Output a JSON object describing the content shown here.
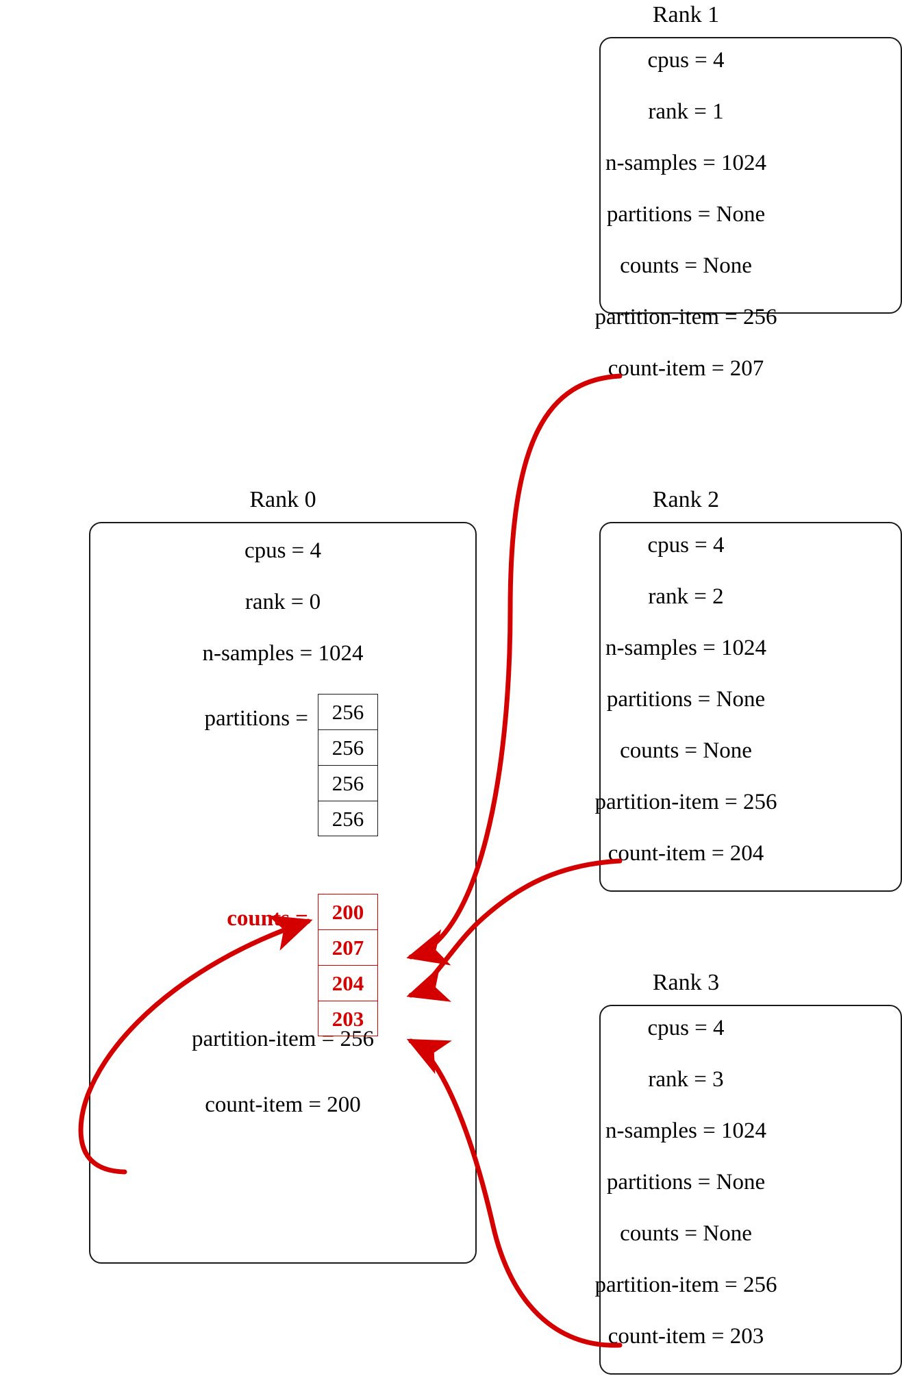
{
  "diagram": {
    "title_prefix": "Rank",
    "accent_color": "#D40000",
    "line_color": "#1a1a1a"
  },
  "ranks": [
    {
      "title": "Rank 0",
      "fields": [
        {
          "key": "cpus",
          "eq": "=",
          "value": "4"
        },
        {
          "key": "rank",
          "eq": "=",
          "value": "0"
        },
        {
          "key": "n_samples",
          "eq": "=",
          "value": "1024"
        }
      ],
      "partitions_label": "partitions =",
      "partitions": [
        "256",
        "256",
        "256",
        "256"
      ],
      "counts_label": "counts =",
      "counts": [
        "200",
        "207",
        "204",
        "203"
      ],
      "footer": [
        {
          "key": "partition_item",
          "eq": "=",
          "value": "256"
        },
        {
          "key": "count_item",
          "eq": "=",
          "value": "200"
        }
      ]
    },
    {
      "title": "Rank 1",
      "fields": [
        {
          "key": "cpus",
          "eq": "=",
          "value": "4"
        },
        {
          "key": "rank",
          "eq": "=",
          "value": "1"
        },
        {
          "key": "n_samples",
          "eq": "=",
          "value": "1024"
        },
        {
          "key": "partitions",
          "eq": "=",
          "value": "None"
        },
        {
          "key": "counts",
          "eq": "=",
          "value": "None"
        },
        {
          "key": "partition_item",
          "eq": "=",
          "value": "256"
        },
        {
          "key": "count_item",
          "eq": "=",
          "value": "207"
        }
      ]
    },
    {
      "title": "Rank 2",
      "fields": [
        {
          "key": "cpus",
          "eq": "=",
          "value": "4"
        },
        {
          "key": "rank",
          "eq": "=",
          "value": "2"
        },
        {
          "key": "n_samples",
          "eq": "=",
          "value": "1024"
        },
        {
          "key": "partitions",
          "eq": "=",
          "value": "None"
        },
        {
          "key": "counts",
          "eq": "=",
          "value": "None"
        },
        {
          "key": "partition_item",
          "eq": "=",
          "value": "256"
        },
        {
          "key": "count_item",
          "eq": "=",
          "value": "204"
        }
      ]
    },
    {
      "title": "Rank 3",
      "fields": [
        {
          "key": "cpus",
          "eq": "=",
          "value": "4"
        },
        {
          "key": "rank",
          "eq": "=",
          "value": "3"
        },
        {
          "key": "n_samples",
          "eq": "=",
          "value": "1024"
        },
        {
          "key": "partitions",
          "eq": "=",
          "value": "None"
        },
        {
          "key": "counts",
          "eq": "=",
          "value": "None"
        },
        {
          "key": "partition_item",
          "eq": "=",
          "value": "256"
        },
        {
          "key": "count_item",
          "eq": "=",
          "value": "203"
        }
      ]
    }
  ],
  "labels": {
    "rank0_title": "Rank 0",
    "rank1_title": "Rank 1",
    "rank2_title": "Rank 2",
    "rank3_title": "Rank 3",
    "r0_cpus": "cpus = 4",
    "r0_rank": "rank = 0",
    "r0_nsamples": "n‐samples = 1024",
    "r0_partitions_label": "partitions =",
    "r0_counts_label": "counts =",
    "r0_partition_item": "partition‐item = 256",
    "r0_count_item": "count‐item = 200",
    "r1_cpus": "cpus = 4",
    "r1_rank": "rank = 1",
    "r1_nsamples": "n‐samples = 1024",
    "r1_partitions": "partitions = None",
    "r1_counts": "counts = None",
    "r1_partition_item": "partition‐item = 256",
    "r1_count_item": "count‐item = 207",
    "r2_cpus": "cpus = 4",
    "r2_rank": "rank = 2",
    "r2_nsamples": "n‐samples = 1024",
    "r2_partitions": "partitions = None",
    "r2_counts": "counts = None",
    "r2_partition_item": "partition‐item = 256",
    "r2_count_item": "count‐item = 204",
    "r3_cpus": "cpus = 4",
    "r3_rank": "rank = 3",
    "r3_nsamples": "n‐samples = 1024",
    "r3_partitions": "partitions = None",
    "r3_counts": "counts = None",
    "r3_partition_item": "partition‐item = 256",
    "r3_count_item": "count‐item = 203",
    "p0": "256",
    "p1": "256",
    "p2": "256",
    "p3": "256",
    "c0": "200",
    "c1": "207",
    "c2": "204",
    "c3": "203"
  }
}
